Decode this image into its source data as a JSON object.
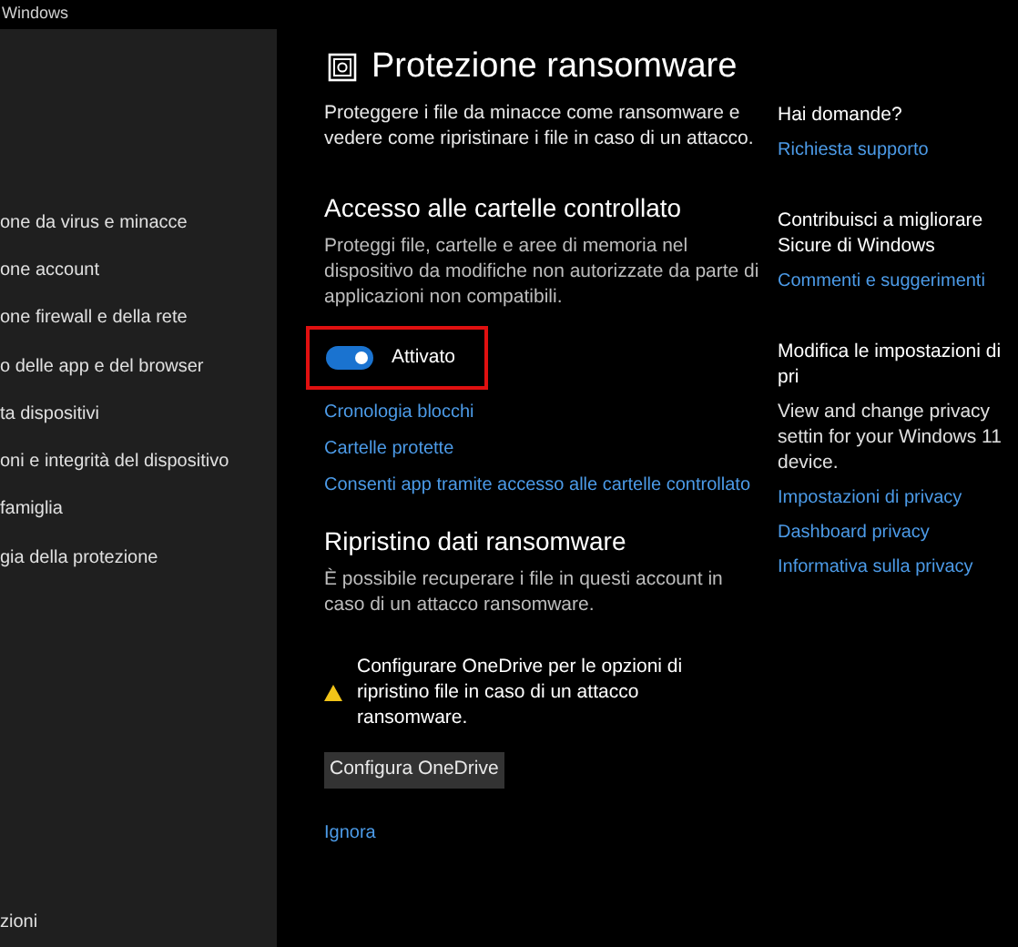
{
  "window": {
    "title": "Windows"
  },
  "sidebar": {
    "items": [
      {
        "label": "one da virus e minacce"
      },
      {
        "label": "one account"
      },
      {
        "label": "one firewall e della rete"
      },
      {
        "label": "o delle app e del browser"
      },
      {
        "label": "ta dispositivi"
      },
      {
        "label": "oni e integrità del dispositivo"
      },
      {
        "label": "famiglia"
      },
      {
        "label": "gia della protezione"
      }
    ],
    "footer": "zioni"
  },
  "page": {
    "title": "Protezione ransomware",
    "description": "Proteggere i file da minacce come ransomware e vedere come ripristinare i file in caso di un attacco."
  },
  "controlled_folder_access": {
    "heading": "Accesso alle cartelle controllato",
    "description": "Proteggi file, cartelle e aree di memoria nel dispositivo da modifiche non autorizzate da parte di applicazioni non compatibili.",
    "toggle": {
      "on": true,
      "label": "Attivato"
    },
    "links": [
      "Cronologia blocchi",
      "Cartelle protette",
      "Consenti app tramite accesso alle cartelle controllato"
    ]
  },
  "recovery": {
    "heading": "Ripristino dati ransomware",
    "description": "È possibile recuperare i file in questi account in caso di un attacco ransomware.",
    "warning": "Configurare OneDrive per le opzioni di ripristino file in caso di un attacco ransomware.",
    "button": "Configura OneDrive",
    "link": "Ignora"
  },
  "right_panel": [
    {
      "heading": "Hai domande?",
      "links": [
        "Richiesta supporto"
      ]
    },
    {
      "heading": "Contribuisci a migliorare Sicure di Windows",
      "links": [
        "Commenti e suggerimenti"
      ]
    },
    {
      "heading": "Modifica le impostazioni di pri",
      "text": "View and change privacy settin for your Windows 11 device.",
      "links": [
        "Impostazioni di privacy",
        "Dashboard privacy",
        "Informativa sulla privacy"
      ]
    }
  ]
}
